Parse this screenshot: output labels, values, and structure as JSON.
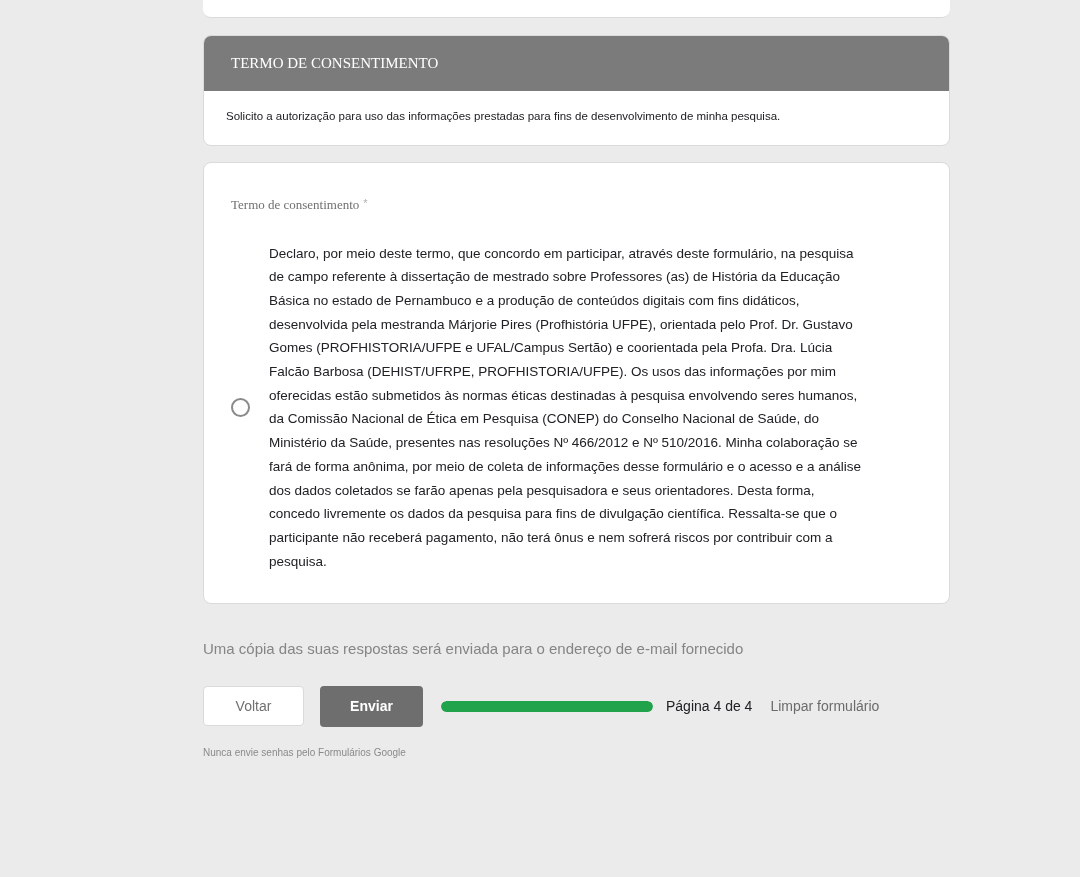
{
  "section": {
    "title": "TERMO DE CONSENTIMENTO",
    "description": "Solicito a autorização para uso das informações prestadas para fins de desenvolvimento de minha pesquisa."
  },
  "question": {
    "title": "Termo de consentimento",
    "required_mark": "*",
    "options": [
      {
        "label": "Declaro, por meio deste termo, que concordo em participar, através deste formulário, na pesquisa de campo referente à dissertação de mestrado sobre Professores (as) de História da Educação Básica no estado de Pernambuco e a produção de conteúdos digitais com fins didáticos, desenvolvida pela mestranda Márjorie Pires (Profhistória UFPE), orientada pelo Prof. Dr. Gustavo Gomes (PROFHISTORIA/UFPE e UFAL/Campus Sertão) e coorientada pela Profa. Dra. Lúcia Falcão Barbosa (DEHIST/UFRPE, PROFHISTORIA/UFPE). Os usos das informações por mim oferecidas estão submetidos às normas éticas destinadas à pesquisa envolvendo seres humanos, da Comissão Nacional de Ética em Pesquisa (CONEP) do Conselho Nacional de Saúde, do Ministério da Saúde, presentes nas resoluções Nº 466/2012 e Nº 510/2016. Minha colaboração se fará de forma anônima, por meio de coleta de informações desse formulário e o acesso e a análise dos dados coletados se farão apenas pela pesquisadora e seus orientadores. Desta forma, concedo livremente os dados da pesquisa para fins de divulgação científica. Ressalta-se que o participante não receberá pagamento, não terá ônus e nem sofrerá riscos por contribuir com a pesquisa.",
        "selected": false
      }
    ]
  },
  "copy_notice": "Uma cópia das suas respostas será enviada para o endereço de e-mail fornecido",
  "footer": {
    "back_button": "Voltar",
    "submit_button": "Enviar",
    "progress": {
      "level": 1
    },
    "page_indicator": "Página 4 de 4",
    "clear_link": "Limpar formulário",
    "password_warning": "Nunca envie senhas pelo Formulários Google"
  }
}
